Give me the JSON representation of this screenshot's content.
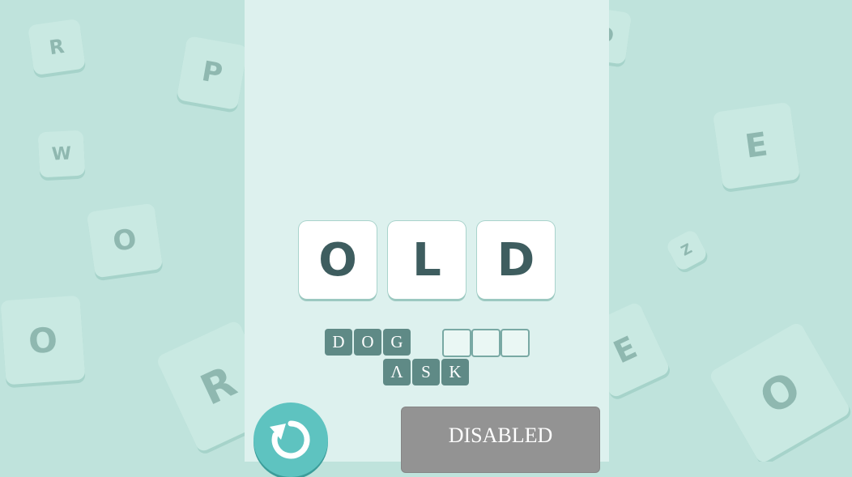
{
  "background_letters": [
    "R",
    "P",
    "W",
    "O",
    "O",
    "R",
    "D",
    "E",
    "Z",
    "E",
    "O"
  ],
  "word": [
    "O",
    "L",
    "D"
  ],
  "hint_row1": [
    "D",
    "O",
    "G"
  ],
  "hint_row2": [
    "Λ",
    "S",
    "K"
  ],
  "empty_slots": 3,
  "undo": {
    "icon": "undo-icon"
  },
  "action_button": {
    "label": "DISABLED"
  },
  "colors": {
    "accent": "#5ec3c0",
    "tile_dark": "#5f8a86",
    "disabled": "#939393"
  }
}
